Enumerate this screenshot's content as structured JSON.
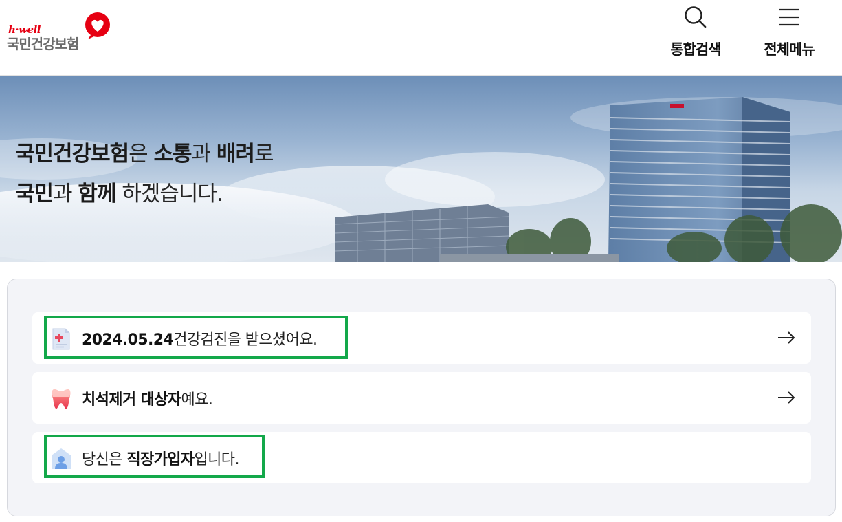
{
  "header": {
    "logo_sub": "h·well",
    "logo_main": "국민건강보험",
    "search_label": "통합검색",
    "menu_label": "전체메뉴"
  },
  "banner": {
    "line1": {
      "a_bold": "국민건강보험",
      "b": "은 ",
      "c_bold": "소통",
      "d": "과 ",
      "e_bold": "배려",
      "f": "로"
    },
    "line2": {
      "a_bold": "국민",
      "b": "과 ",
      "c_bold": "함께",
      "d": " 하겠습니다."
    }
  },
  "items": [
    {
      "icon": "medical-checkup-document-icon",
      "bold": "2024.05.24",
      "rest": "건강검진을 받으셨어요."
    },
    {
      "icon": "tooth-icon",
      "bold": "치석제거 대상자",
      "rest": "예요."
    },
    {
      "icon": "home-person-icon",
      "pre": "당신은 ",
      "bold": "직장가입자",
      "rest": "입니다."
    }
  ],
  "colors": {
    "brand_red": "#e60012",
    "highlight_green": "#13a84a",
    "panel_bg": "#f3f4f8"
  }
}
